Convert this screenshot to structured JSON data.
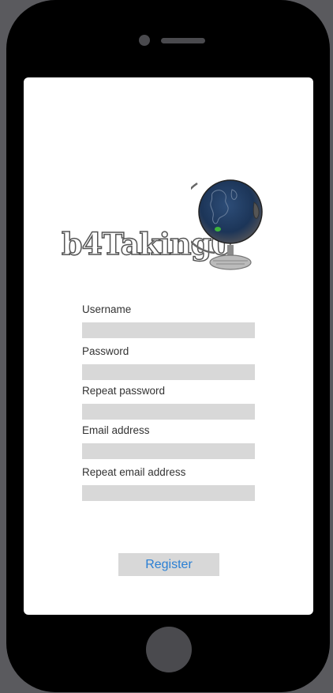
{
  "logo": {
    "text": "b4Taking0"
  },
  "form": {
    "fields": [
      {
        "label": "Username",
        "value": "",
        "placeholder": ""
      },
      {
        "label": "Password",
        "value": "",
        "placeholder": ""
      },
      {
        "label": "Repeat password",
        "value": "",
        "placeholder": ""
      },
      {
        "label": "Email address",
        "value": "",
        "placeholder": ""
      },
      {
        "label": "Repeat email address",
        "value": "",
        "placeholder": ""
      }
    ],
    "register_label": "Register"
  },
  "colors": {
    "background": "#5a5a5e",
    "phone_body": "#000000",
    "screen": "#ffffff",
    "input_fill": "#d8d8d8",
    "link_blue": "#2a7fd4",
    "globe_ocean": "#1c3558"
  },
  "icons": {
    "logo_image": "globe-icon",
    "phone_home": "home-button",
    "phone_speaker": "speaker-icon"
  }
}
